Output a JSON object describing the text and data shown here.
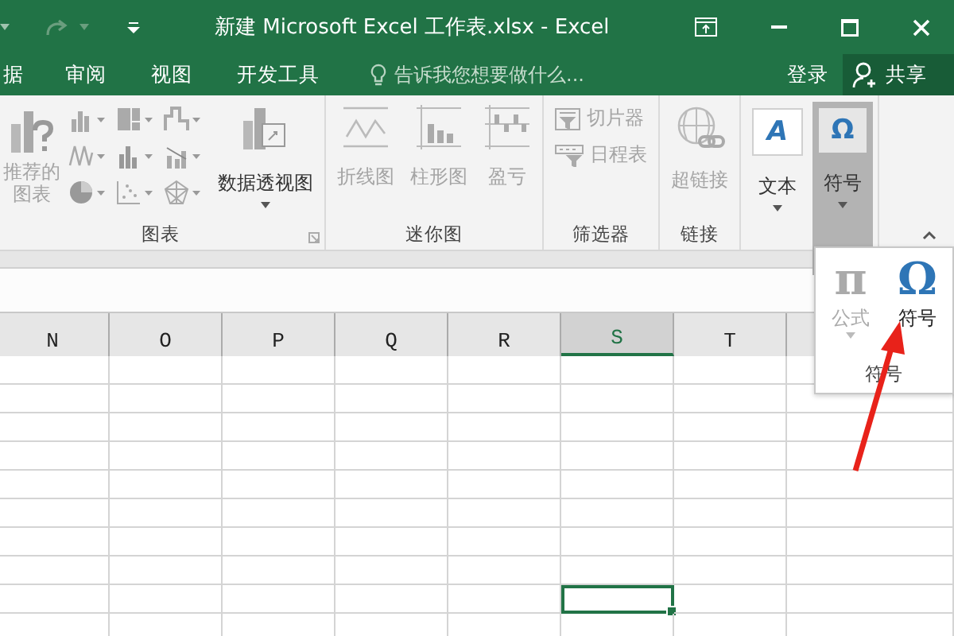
{
  "title_bar": {
    "title": "新建 Microsoft Excel 工作表.xlsx - Excel"
  },
  "tabs": [
    {
      "label": "据"
    },
    {
      "label": "审阅"
    },
    {
      "label": "视图"
    },
    {
      "label": "开发工具"
    }
  ],
  "tell_me": {
    "placeholder": "告诉我您想要做什么..."
  },
  "sign_in": "登录",
  "share": "共享",
  "ribbon": {
    "groups": [
      {
        "kind": "charts",
        "label": "图表",
        "recommended": {
          "label": "推荐的图表",
          "disabled": true
        },
        "pivot": {
          "label": "数据透视图",
          "disabled": false,
          "dropdown": true
        }
      },
      {
        "kind": "large",
        "label": "迷你图",
        "buttons": [
          {
            "label": "折线图",
            "disabled": true,
            "dropdown": false
          },
          {
            "label": "柱形图",
            "disabled": true,
            "dropdown": false
          },
          {
            "label": "盈亏",
            "disabled": true,
            "dropdown": false
          }
        ]
      },
      {
        "kind": "small",
        "label": "筛选器",
        "buttons": [
          {
            "label": "切片器",
            "disabled": true
          },
          {
            "label": "日程表",
            "disabled": true
          }
        ]
      },
      {
        "kind": "large",
        "label": "链接",
        "buttons": [
          {
            "label": "超链接",
            "disabled": true,
            "dropdown": false
          }
        ]
      },
      {
        "kind": "large",
        "buttons": [
          {
            "glyph": "A",
            "label": "文本",
            "disabled": false,
            "dropdown": true,
            "selected": false
          },
          {
            "glyph": "Ω",
            "label": "符号",
            "disabled": false,
            "dropdown": true,
            "selected": true
          }
        ]
      }
    ]
  },
  "symbol_popup": {
    "items": [
      {
        "glyph": "π",
        "label": "公式",
        "disabled": true,
        "dropdown": true
      },
      {
        "glyph": "Ω",
        "label": "符号",
        "disabled": false,
        "dropdown": false
      }
    ],
    "label": "符号"
  },
  "columns": [
    {
      "label": "N",
      "selected": false
    },
    {
      "label": "O",
      "selected": false
    },
    {
      "label": "P",
      "selected": false
    },
    {
      "label": "Q",
      "selected": false
    },
    {
      "label": "R",
      "selected": false
    },
    {
      "label": "S",
      "selected": true
    },
    {
      "label": "T",
      "selected": false
    }
  ],
  "rows": [
    {
      "selected": false
    },
    {
      "selected": false
    },
    {
      "selected": false
    },
    {
      "selected": false
    },
    {
      "selected": false
    },
    {
      "selected": false
    },
    {
      "selected": false
    },
    {
      "selected": false
    },
    {
      "selected": true
    },
    {
      "selected": false
    }
  ]
}
